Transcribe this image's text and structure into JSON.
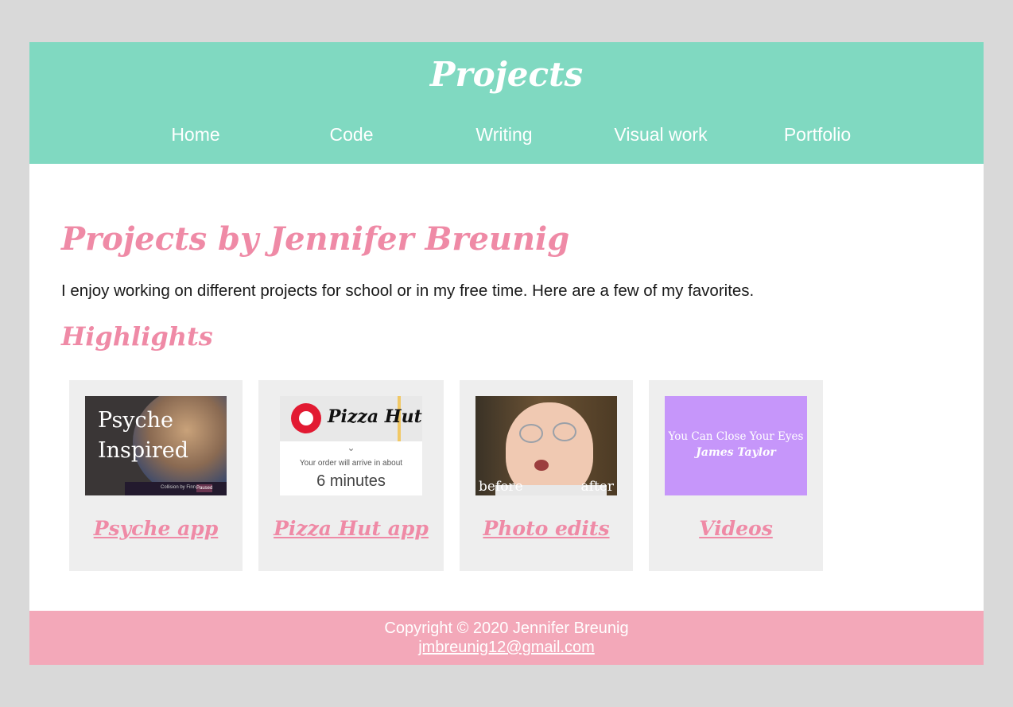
{
  "header": {
    "title": "Projects",
    "nav": [
      {
        "label": "Home"
      },
      {
        "label": "Code"
      },
      {
        "label": "Writing"
      },
      {
        "label": "Visual work"
      },
      {
        "label": "Portfolio"
      }
    ]
  },
  "main": {
    "heading": "Projects by Jennifer Breunig",
    "intro": "I enjoy working on different projects for school or in my free time. Here are a few of my favorites.",
    "highlights_heading": "Highlights",
    "cards": [
      {
        "link_label": "Psyche app",
        "thumbnail": {
          "text": "Psyche Inspired",
          "bar_text": "Collision by Finn Wiki",
          "badge": "Paused"
        }
      },
      {
        "link_label": "Pizza Hut app",
        "thumbnail": {
          "logo": "Pizza Hut",
          "chevron_icon": "chevron-down-icon",
          "caption": "Your order will arrive in about",
          "eta": "6 minutes"
        }
      },
      {
        "link_label": "Photo edits",
        "thumbnail": {
          "left_label": "before",
          "right_label": "after"
        }
      },
      {
        "link_label": "Videos",
        "thumbnail": {
          "title": "You Can Close Your Eyes",
          "artist": "James Taylor"
        }
      }
    ]
  },
  "footer": {
    "copyright": "Copyright © 2020 Jennifer Breunig",
    "email": "jmbreunig12@gmail.com"
  },
  "colors": {
    "background": "#d9d9d9",
    "header": "#80d9c1",
    "accent_pink": "#ef8aa6",
    "footer": "#f3a8b9",
    "card": "#eeeeee"
  }
}
